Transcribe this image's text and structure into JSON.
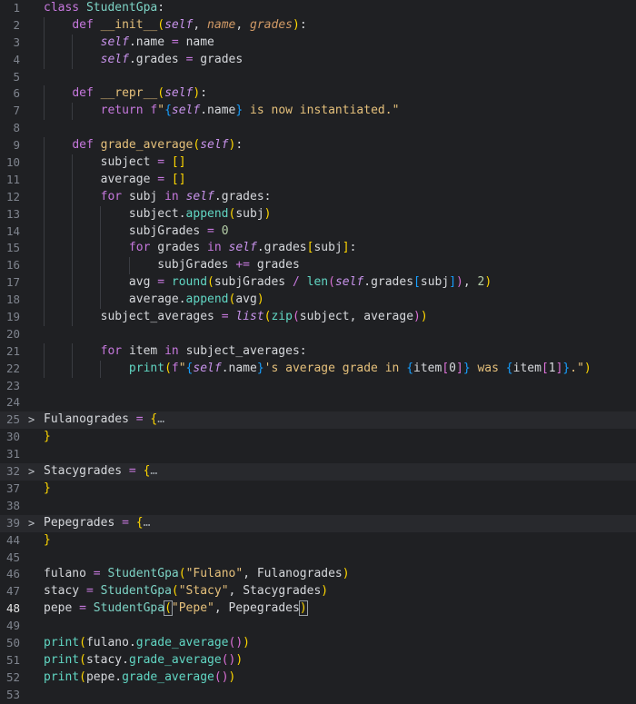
{
  "editor": {
    "language": "python",
    "current_line": "48",
    "colors": {
      "background": "#1f2023",
      "keyword": "#c678dd",
      "class_name": "#7dd3c5",
      "function_def": "#e5c07b",
      "self": "#c792ea",
      "line_number": "#7f848e"
    },
    "lines": [
      {
        "n": "1",
        "text": "class StudentGpa:"
      },
      {
        "n": "2",
        "text": "    def __init__(self, name, grades):"
      },
      {
        "n": "3",
        "text": "        self.name = name"
      },
      {
        "n": "4",
        "text": "        self.grades = grades"
      },
      {
        "n": "5",
        "text": ""
      },
      {
        "n": "6",
        "text": "    def __repr__(self):"
      },
      {
        "n": "7",
        "text": "        return f\"{self.name} is now instantiated.\""
      },
      {
        "n": "8",
        "text": ""
      },
      {
        "n": "9",
        "text": "    def grade_average(self):"
      },
      {
        "n": "10",
        "text": "        subject = []"
      },
      {
        "n": "11",
        "text": "        average = []"
      },
      {
        "n": "12",
        "text": "        for subj in self.grades:"
      },
      {
        "n": "13",
        "text": "            subject.append(subj)"
      },
      {
        "n": "14",
        "text": "            subjGrades = 0"
      },
      {
        "n": "15",
        "text": "            for grades in self.grades[subj]:"
      },
      {
        "n": "16",
        "text": "                subjGrades += grades"
      },
      {
        "n": "17",
        "text": "            avg = round(subjGrades / len(self.grades[subj]), 2)"
      },
      {
        "n": "18",
        "text": "            average.append(avg)"
      },
      {
        "n": "19",
        "text": "        subject_averages = list(zip(subject, average))"
      },
      {
        "n": "20",
        "text": ""
      },
      {
        "n": "21",
        "text": "        for item in subject_averages:"
      },
      {
        "n": "22",
        "text": "            print(f\"{self.name}'s average grade in {item[0]} was {item[1]}.\")"
      },
      {
        "n": "23",
        "text": ""
      },
      {
        "n": "24",
        "text": ""
      },
      {
        "n": "25",
        "text": "Fulanogrades = {…",
        "folded": true
      },
      {
        "n": "30",
        "text": "}"
      },
      {
        "n": "31",
        "text": ""
      },
      {
        "n": "32",
        "text": "Stacygrades = {…",
        "folded": true
      },
      {
        "n": "37",
        "text": "}"
      },
      {
        "n": "38",
        "text": ""
      },
      {
        "n": "39",
        "text": "Pepegrades = {…",
        "folded": true
      },
      {
        "n": "44",
        "text": "}"
      },
      {
        "n": "45",
        "text": ""
      },
      {
        "n": "46",
        "text": "fulano = StudentGpa(\"Fulano\", Fulanogrades)"
      },
      {
        "n": "47",
        "text": "stacy = StudentGpa(\"Stacy\", Stacygrades)"
      },
      {
        "n": "48",
        "text": "pepe = StudentGpa(\"Pepe\", Pepegrades)"
      },
      {
        "n": "49",
        "text": ""
      },
      {
        "n": "50",
        "text": "print(fulano.grade_average())"
      },
      {
        "n": "51",
        "text": "print(stacy.grade_average())"
      },
      {
        "n": "52",
        "text": "print(pepe.grade_average())"
      },
      {
        "n": "53",
        "text": ""
      }
    ],
    "fold_icon": "chevron-right-icon",
    "fold_glyph": ">"
  }
}
